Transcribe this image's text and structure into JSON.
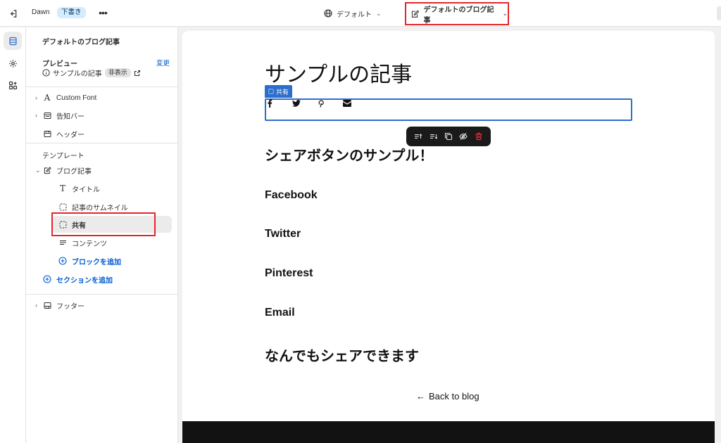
{
  "topbar": {
    "theme_name": "Dawn",
    "theme_status": "下書き",
    "more_label": "•••",
    "language_label": "デフォルト",
    "template_label": "デフォルトのブログ記事"
  },
  "sidebar": {
    "title": "デフォルトのブログ記事",
    "preview": {
      "label": "プレビュー",
      "change_label": "変更",
      "article_label": "サンプルの記事",
      "hidden_badge": "非表示"
    },
    "header_sections": [
      {
        "label": "Custom Font",
        "icon": "font-icon"
      },
      {
        "label": "告知バー",
        "icon": "announcement-bar-icon"
      },
      {
        "label": "ヘッダー",
        "icon": "header-icon"
      }
    ],
    "template_label": "テンプレート",
    "template_section": {
      "label": "ブログ記事",
      "icon": "blog-post-icon"
    },
    "blocks": [
      {
        "label": "タイトル",
        "icon": "text-icon"
      },
      {
        "label": "記事のサムネイル",
        "icon": "placeholder-block-icon"
      },
      {
        "label": "共有",
        "icon": "placeholder-block-icon"
      },
      {
        "label": "コンテンツ",
        "icon": "text-lines-icon"
      }
    ],
    "add_block_label": "ブロックを追加",
    "add_section_label": "セクションを追加",
    "footer_section": {
      "label": "フッター",
      "icon": "footer-icon"
    }
  },
  "preview": {
    "article_title": "サンプルの記事",
    "share_tag": "共有",
    "share_icons": [
      "facebook-icon",
      "twitter-icon",
      "pinterest-icon",
      "email-icon"
    ],
    "headings": {
      "intro": "シェアボタンのサンプル！",
      "facebook": "Facebook",
      "twitter": "Twitter",
      "pinterest": "Pinterest",
      "email": "Email",
      "outro": "なんでもシェアできます"
    },
    "back_link": "Back to blog",
    "back_arrow": "←"
  },
  "colors": {
    "accent_blue": "#2c6ecb",
    "highlight_red": "#e4262b",
    "link_blue": "#005bd3",
    "delete_red": "#e22c38"
  }
}
